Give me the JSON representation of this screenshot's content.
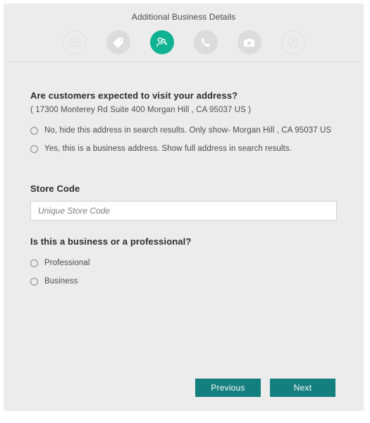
{
  "header": {
    "title": "Additional Business Details",
    "steps": [
      {
        "name": "business-card-icon",
        "state": "incomplete"
      },
      {
        "name": "tag-icon",
        "state": "complete"
      },
      {
        "name": "person-key-icon",
        "state": "active"
      },
      {
        "name": "phone-icon",
        "state": "complete"
      },
      {
        "name": "camera-icon",
        "state": "complete"
      },
      {
        "name": "clock-icon",
        "state": "incomplete"
      }
    ]
  },
  "main": {
    "visit_question": {
      "heading": "Are customers expected to visit your address?",
      "address": "( 17300 Monterey Rd Suite 400 Morgan Hill , CA 95037 US )",
      "options": [
        {
          "label": "No, hide this address in search results. Only show- Morgan Hill , CA 95037 US",
          "selected": false
        },
        {
          "label": "Yes, this is a business address. Show full address in search results.",
          "selected": false
        }
      ]
    },
    "store_code": {
      "label": "Store Code",
      "value": "",
      "placeholder": "Unique Store Code"
    },
    "business_type": {
      "heading": "Is this a business or a professional?",
      "options": [
        {
          "label": "Professional",
          "selected": false
        },
        {
          "label": "Business",
          "selected": false
        }
      ]
    }
  },
  "footer": {
    "previous_label": "Previous",
    "next_label": "Next"
  },
  "colors": {
    "accent_button": "#157f7f",
    "active_step": "#10b391",
    "card_background": "#ececec",
    "inactive_step": "#dcdcdc"
  }
}
